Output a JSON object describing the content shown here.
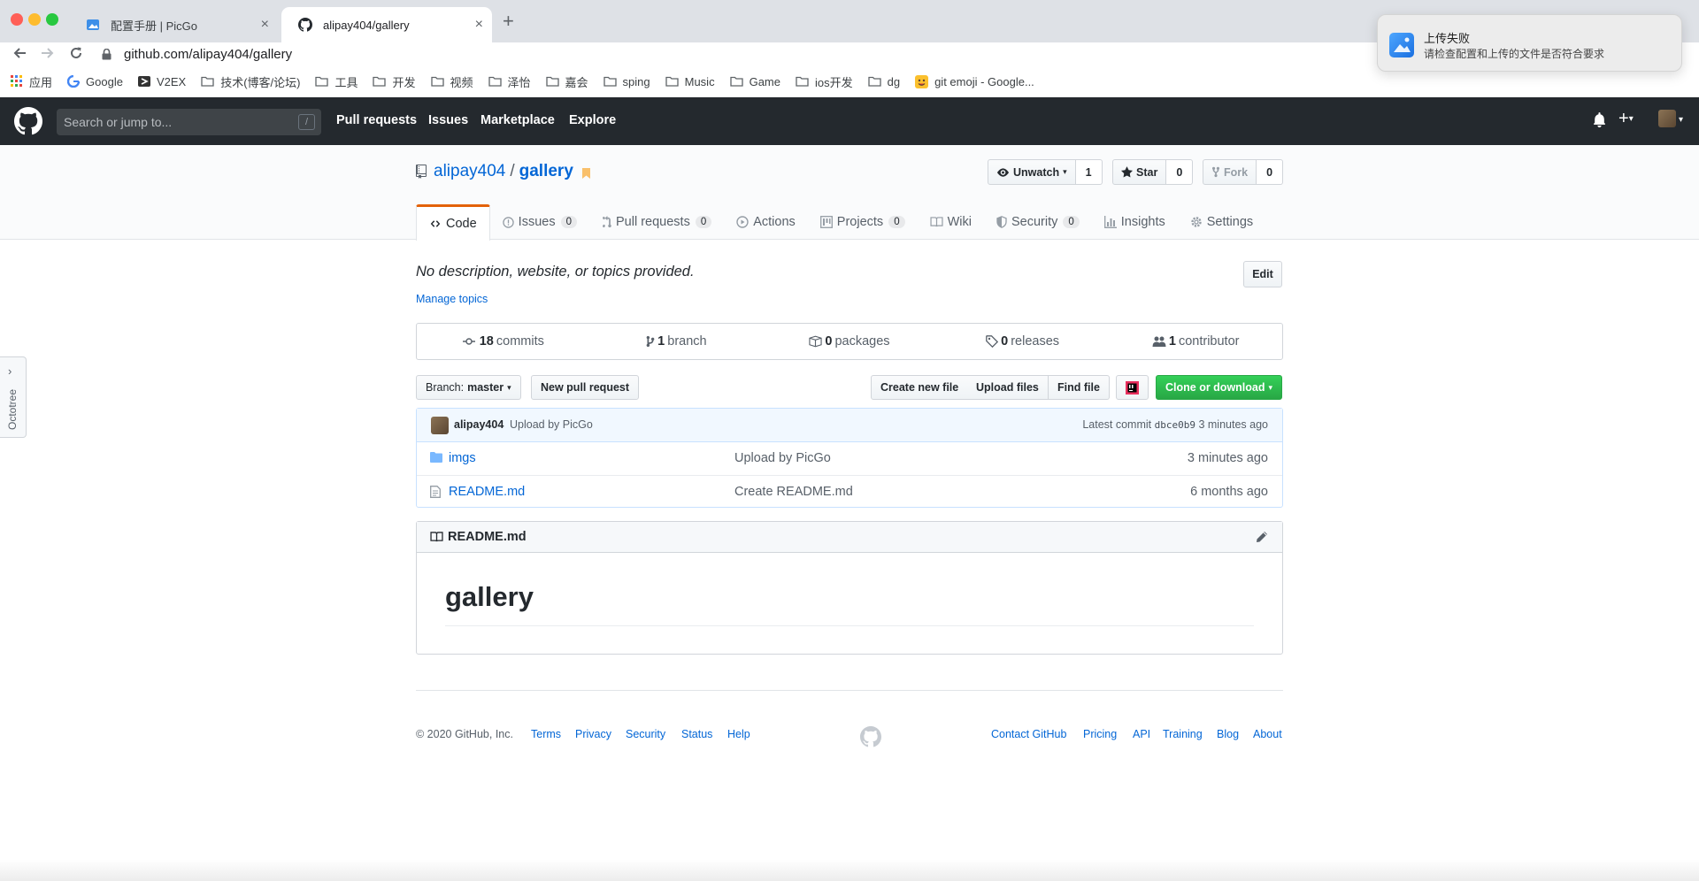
{
  "browser": {
    "tabs": [
      {
        "title": "配置手册 | PicGo",
        "favicon": "picgo-icon"
      },
      {
        "title": "alipay404/gallery",
        "favicon": "github-icon"
      }
    ],
    "url": "github.com/alipay404/gallery",
    "bookmarks": [
      {
        "label": "应用",
        "icon": "apps-icon"
      },
      {
        "label": "Google",
        "icon": "google-icon"
      },
      {
        "label": "V2EX",
        "icon": "v2ex-icon"
      },
      {
        "label": "技术(博客/论坛)",
        "icon": "folder-icon"
      },
      {
        "label": "工具",
        "icon": "folder-icon"
      },
      {
        "label": "开发",
        "icon": "folder-icon"
      },
      {
        "label": "视频",
        "icon": "folder-icon"
      },
      {
        "label": "泽怡",
        "icon": "folder-icon"
      },
      {
        "label": "嘉会",
        "icon": "folder-icon"
      },
      {
        "label": "sping",
        "icon": "folder-icon"
      },
      {
        "label": "Music",
        "icon": "folder-icon"
      },
      {
        "label": "Game",
        "icon": "folder-icon"
      },
      {
        "label": "ios开发",
        "icon": "folder-icon"
      },
      {
        "label": "dg",
        "icon": "folder-icon"
      },
      {
        "label": "git emoji - Google...",
        "icon": "emoji-icon"
      }
    ]
  },
  "notification": {
    "title": "上传失败",
    "body": "请检查配置和上传的文件是否符合要求"
  },
  "octotree": {
    "label": "Octotree"
  },
  "header": {
    "search_placeholder": "Search or jump to...",
    "search_key": "/",
    "nav": [
      "Pull requests",
      "Issues",
      "Marketplace",
      "Explore"
    ]
  },
  "repo": {
    "owner": "alipay404",
    "name": "gallery",
    "watch": {
      "label": "Unwatch",
      "count": "1"
    },
    "star": {
      "label": "Star",
      "count": "0"
    },
    "fork": {
      "label": "Fork",
      "count": "0"
    },
    "tabs": [
      {
        "label": "Code",
        "count": null
      },
      {
        "label": "Issues",
        "count": "0"
      },
      {
        "label": "Pull requests",
        "count": "0"
      },
      {
        "label": "Actions",
        "count": null
      },
      {
        "label": "Projects",
        "count": "0"
      },
      {
        "label": "Wiki",
        "count": null
      },
      {
        "label": "Security",
        "count": "0"
      },
      {
        "label": "Insights",
        "count": null
      },
      {
        "label": "Settings",
        "count": null
      }
    ],
    "description": "No description, website, or topics provided.",
    "manage_topics": "Manage topics",
    "edit_label": "Edit",
    "summary": [
      {
        "num": "18",
        "label": "commits"
      },
      {
        "num": "1",
        "label": "branch"
      },
      {
        "num": "0",
        "label": "packages"
      },
      {
        "num": "0",
        "label": "releases"
      },
      {
        "num": "1",
        "label": "contributor"
      }
    ],
    "branch_prefix": "Branch:",
    "branch": "master",
    "new_pr": "New pull request",
    "create_file": "Create new file",
    "upload_files": "Upload files",
    "find_file": "Find file",
    "clone": "Clone or download",
    "commit": {
      "author": "alipay404",
      "message": "Upload by PicGo",
      "latest_prefix": "Latest commit",
      "sha": "dbce0b9",
      "age": "3 minutes ago"
    },
    "files": [
      {
        "name": "imgs",
        "type": "folder",
        "message": "Upload by PicGo",
        "age": "3 minutes ago"
      },
      {
        "name": "README.md",
        "type": "file",
        "message": "Create README.md",
        "age": "6 months ago"
      }
    ],
    "readme": {
      "filename": "README.md",
      "heading": "gallery"
    }
  },
  "footer": {
    "copyright": "© 2020 GitHub, Inc.",
    "left_links": [
      "Terms",
      "Privacy",
      "Security",
      "Status",
      "Help"
    ],
    "right_links": [
      "Contact GitHub",
      "Pricing",
      "API",
      "Training",
      "Blog",
      "About"
    ]
  }
}
